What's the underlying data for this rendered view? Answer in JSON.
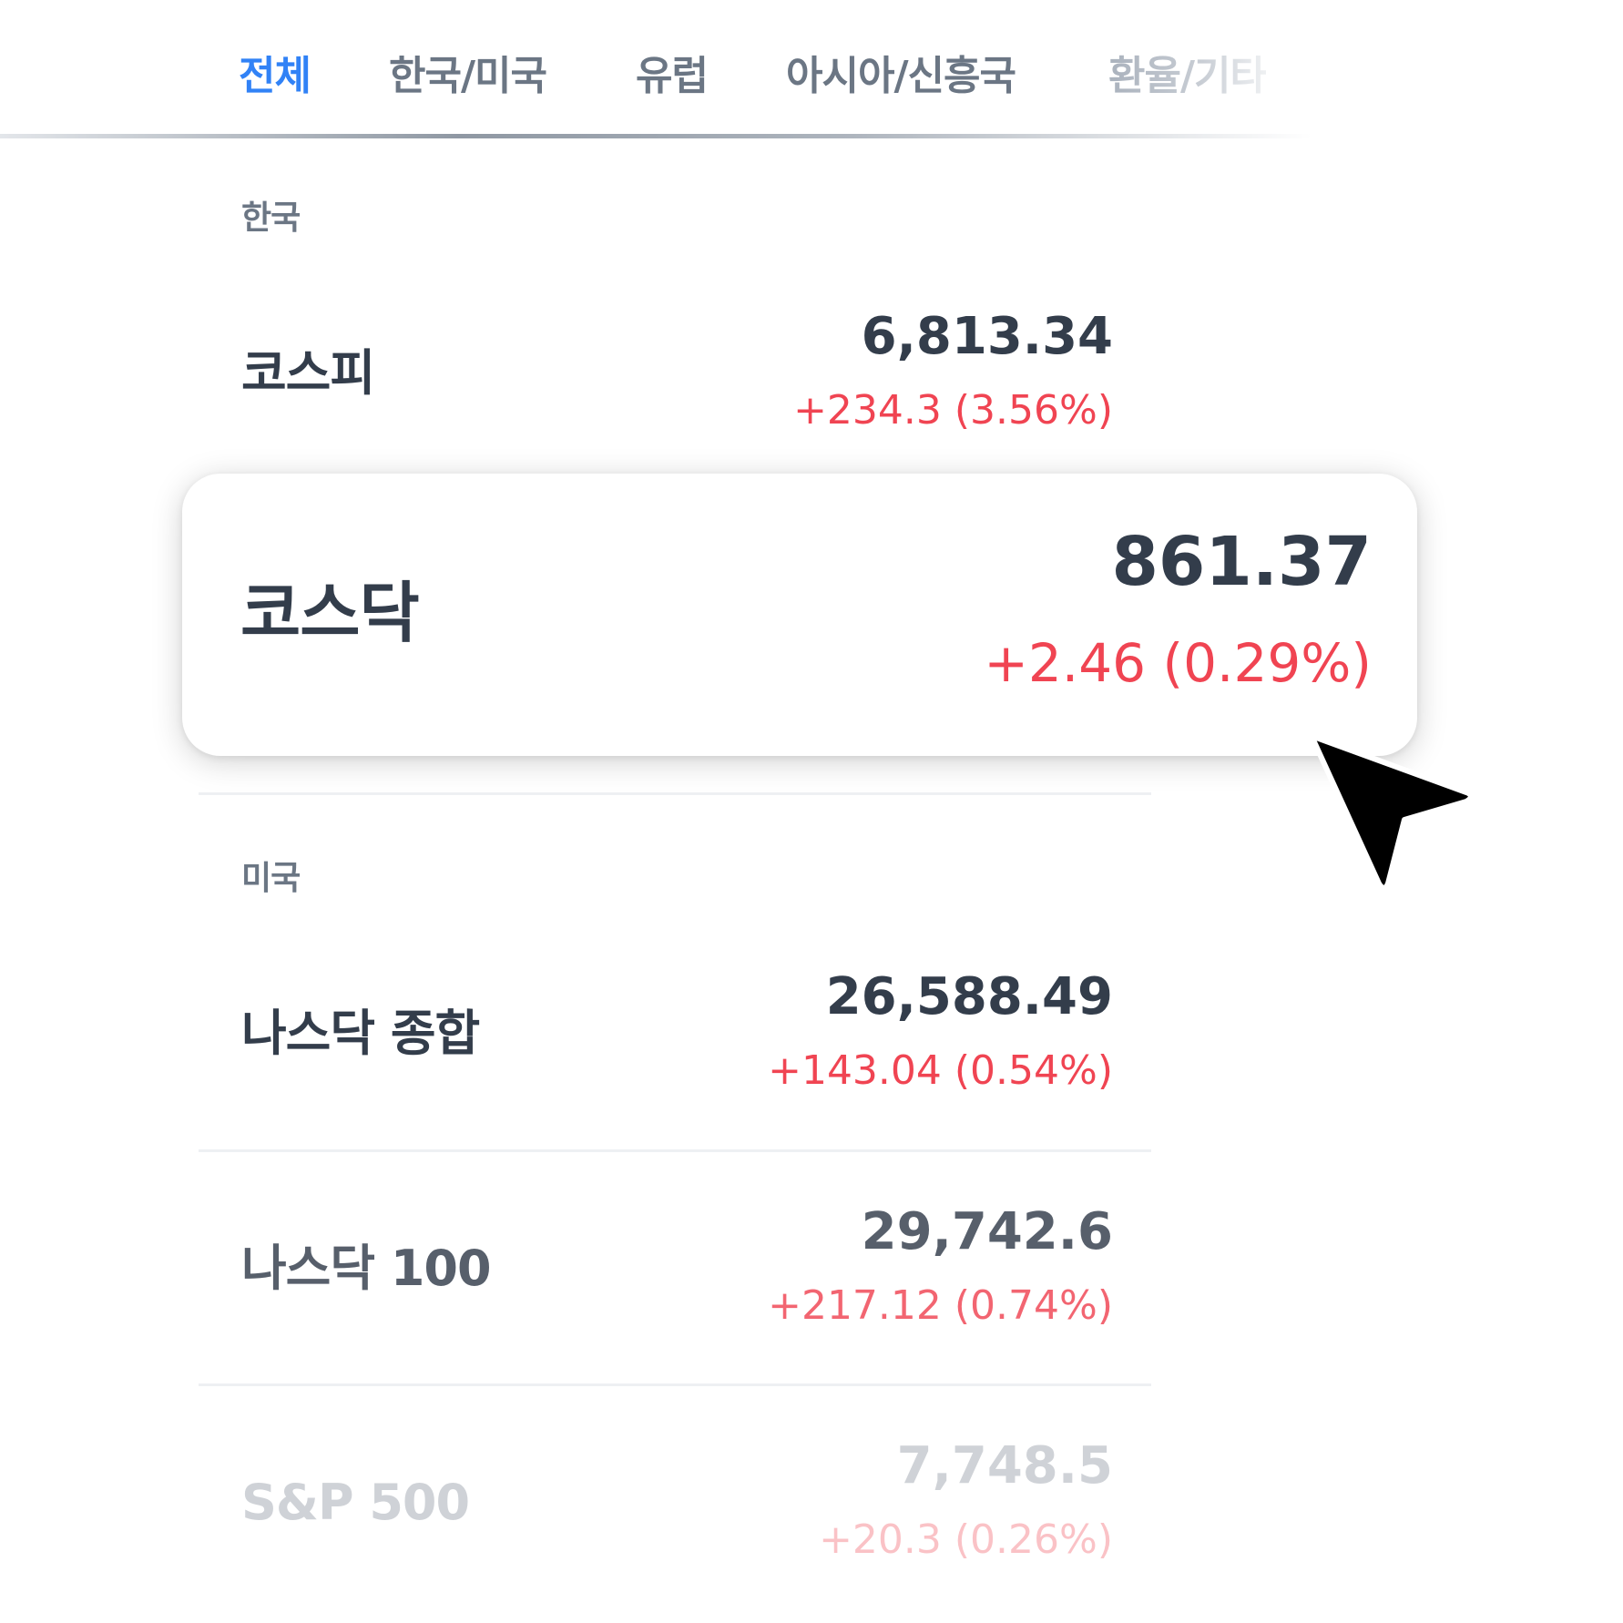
{
  "tabs": [
    {
      "label": "전체",
      "active": true
    },
    {
      "label": "한국/미국",
      "active": false
    },
    {
      "label": "유럽",
      "active": false
    },
    {
      "label": "아시아/신흥국",
      "active": false
    },
    {
      "label": "환율/기타",
      "active": false
    }
  ],
  "sections": {
    "korea": {
      "title": "한국",
      "items": [
        {
          "name": "코스피",
          "price": "6,813.34",
          "change": "+234.3 (3.56%)"
        },
        {
          "name": "코스닥",
          "price": "861.37",
          "change": "+2.46 (0.29%)",
          "highlighted": true
        }
      ]
    },
    "us": {
      "title": "미국",
      "items": [
        {
          "name": "나스닥 종합",
          "price": "26,588.49",
          "change": "+143.04 (0.54%)"
        },
        {
          "name": "나스닥 100",
          "price": "29,742.6",
          "change": "+217.12 (0.74%)"
        },
        {
          "name": "S&P 500",
          "price": "7,748.5",
          "change": "+20.3 (0.26%)"
        }
      ]
    }
  },
  "colors": {
    "accent": "#3182f6",
    "up": "#f04452",
    "text": "#333d4b",
    "muted": "#6b7684"
  },
  "icons": {
    "cursor": "pointer-arrow-icon"
  }
}
